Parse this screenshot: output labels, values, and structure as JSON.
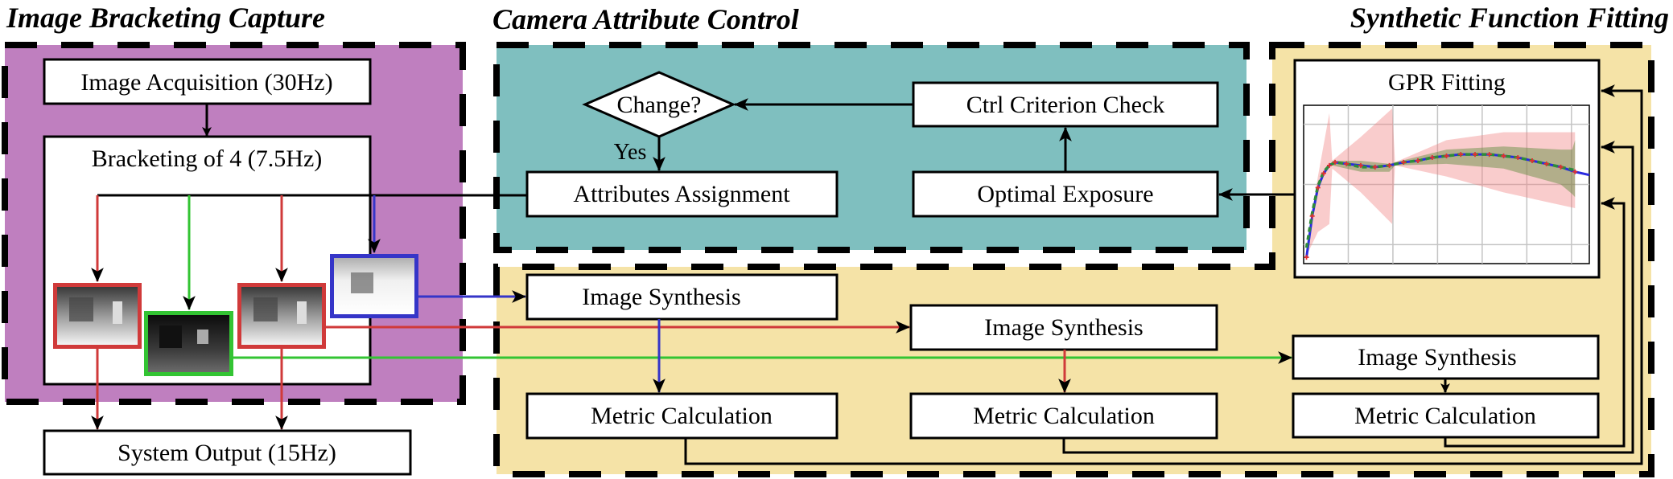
{
  "sections": {
    "bracketing": {
      "title": "Image Bracketing Capture",
      "color": "#bf7fbf"
    },
    "camera_control": {
      "title": "Camera Attribute Control",
      "color": "#7fbfbf"
    },
    "function_fitting": {
      "title": "Synthetic Function Fitting",
      "color": "#f5e3a7"
    }
  },
  "nodes": {
    "image_acquisition": "Image Acquisition (30Hz)",
    "bracketing_of_4": "Bracketing of 4 (7.5Hz)",
    "system_output": "System Output (15Hz)",
    "change_decision": "Change?",
    "yes_label": "Yes",
    "attributes_assignment": "Attributes Assignment",
    "ctrl_criterion_check": "Ctrl Criterion Check",
    "optimal_exposure": "Optimal Exposure",
    "image_synthesis": [
      "Image Synthesis",
      "Image Synthesis",
      "Image Synthesis"
    ],
    "metric_calculation": [
      "Metric Calculation",
      "Metric Calculation",
      "Metric Calculation"
    ],
    "gpr_fitting": "GPR Fitting"
  },
  "bracket_frames": [
    {
      "id": "frame-1",
      "exposure": "mid",
      "color": "#d03a3a"
    },
    {
      "id": "frame-2",
      "exposure": "dark",
      "color": "#33c433"
    },
    {
      "id": "frame-3",
      "exposure": "mid",
      "color": "#d03a3a"
    },
    {
      "id": "frame-4",
      "exposure": "bright",
      "color": "#3535c8"
    }
  ],
  "line_colors": {
    "red": "#d03a3a",
    "green": "#33c433",
    "blue": "#3535c8"
  },
  "chart_data": {
    "type": "line",
    "title": "GPR Fitting",
    "xlabel": "",
    "ylabel": "",
    "x_range": [
      0,
      1
    ],
    "y_range": [
      0,
      1
    ],
    "grid": true,
    "series": [
      {
        "name": "GPR mean (blue)",
        "color": "#2a2ae0",
        "x": [
          0.01,
          0.03,
          0.05,
          0.07,
          0.09,
          0.11,
          0.15,
          0.2,
          0.25,
          0.3,
          0.35,
          0.4,
          0.45,
          0.5,
          0.55,
          0.6,
          0.65,
          0.7,
          0.75,
          0.8,
          0.85,
          0.9,
          0.95,
          1.0
        ],
        "y": [
          0.04,
          0.3,
          0.48,
          0.57,
          0.62,
          0.64,
          0.63,
          0.62,
          0.61,
          0.62,
          0.64,
          0.65,
          0.67,
          0.68,
          0.69,
          0.69,
          0.69,
          0.68,
          0.67,
          0.65,
          0.63,
          0.61,
          0.58,
          0.56
        ]
      },
      {
        "name": "Fit (green dashed)",
        "color": "#2e8b3a",
        "x": [
          0.01,
          0.03,
          0.05,
          0.07,
          0.09,
          0.11,
          0.15,
          0.2,
          0.25,
          0.3,
          0.35,
          0.4,
          0.45,
          0.5,
          0.55,
          0.6,
          0.65,
          0.7,
          0.75,
          0.8,
          0.85,
          0.9,
          0.95
        ],
        "y": [
          0.1,
          0.32,
          0.49,
          0.58,
          0.62,
          0.64,
          0.63,
          0.61,
          0.61,
          0.62,
          0.64,
          0.65,
          0.67,
          0.68,
          0.69,
          0.69,
          0.69,
          0.68,
          0.67,
          0.65,
          0.63,
          0.61,
          0.59
        ]
      }
    ],
    "bands": [
      {
        "name": "wide uncertainty (red)",
        "color": "#f08080",
        "opacity": 0.4,
        "x": [
          0.01,
          0.05,
          0.09,
          0.1,
          0.2,
          0.31,
          0.32,
          0.5,
          0.7,
          0.95
        ],
        "lower": [
          0.05,
          0.2,
          0.25,
          0.6,
          0.45,
          0.25,
          0.62,
          0.55,
          0.45,
          0.35
        ],
        "upper": [
          0.1,
          0.55,
          0.95,
          0.65,
          0.8,
          0.98,
          0.64,
          0.78,
          0.83,
          0.83
        ]
      },
      {
        "name": "narrow uncertainty (green)",
        "color": "#5a8a3a",
        "opacity": 0.45,
        "x": [
          0.1,
          0.2,
          0.3,
          0.32,
          0.5,
          0.7,
          0.9,
          0.94,
          0.95
        ],
        "lower": [
          0.62,
          0.58,
          0.58,
          0.62,
          0.63,
          0.6,
          0.5,
          0.44,
          0.42
        ],
        "upper": [
          0.65,
          0.65,
          0.63,
          0.64,
          0.72,
          0.74,
          0.72,
          0.72,
          0.78
        ]
      }
    ],
    "points": {
      "name": "samples (red stars)",
      "color": "#e03030"
    }
  }
}
